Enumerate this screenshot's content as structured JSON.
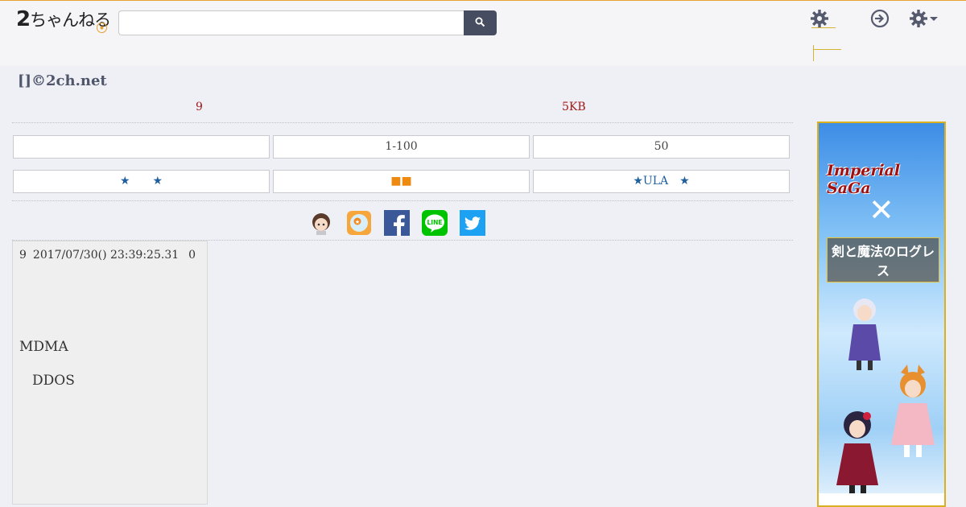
{
  "header": {
    "logo_text_big": "2",
    "logo_text": "ちゃんねる",
    "logo_badge": "",
    "search": {
      "value": "",
      "placeholder": ""
    },
    "tab_label": "",
    "menu_sub": ""
  },
  "thread": {
    "title": "[]©2ch.net",
    "response_count": "9",
    "size": "5KB"
  },
  "nav": {
    "row1": [
      "",
      "1-100",
      "50"
    ],
    "row2": [
      "★　　★",
      "■■",
      "★ULA　★"
    ]
  },
  "share": {
    "icons": [
      "chara-avatar-icon",
      "ball-icon",
      "facebook-icon",
      "line-icon",
      "twitter-icon"
    ],
    "line_label": "LINE"
  },
  "post": {
    "number": "9",
    "datetime": "2017/07/30() 23:39:25.31",
    "id": "0",
    "body_line1": "MDMA",
    "body_line2": "DDOS"
  },
  "ad": {
    "title": "Imperial SaGa",
    "x": "✕",
    "subtitle": "剣と魔法のログレス",
    "banner": ""
  },
  "colors": {
    "accent": "#e8a030",
    "search_button": "#474d60",
    "red_text": "#a01818",
    "blue_text": "#1f5f9e",
    "orange_text": "#ee8a10",
    "facebook": "#3b5998",
    "line": "#00c300",
    "twitter": "#1da1f2"
  }
}
